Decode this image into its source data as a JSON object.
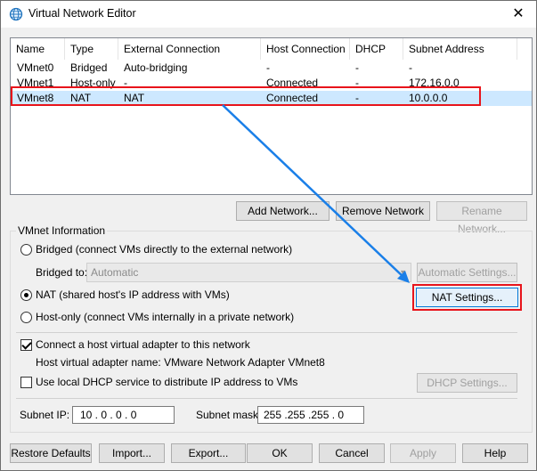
{
  "window": {
    "title": "Virtual Network Editor",
    "close_glyph": "✕"
  },
  "columns": [
    "Name",
    "Type",
    "External Connection",
    "Host Connection",
    "DHCP",
    "Subnet Address"
  ],
  "rows": [
    [
      "VMnet0",
      "Bridged",
      "Auto-bridging",
      "-",
      "-",
      "-"
    ],
    [
      "VMnet1",
      "Host-only",
      "-",
      "Connected",
      "-",
      "172.16.0.0"
    ],
    [
      "VMnet8",
      "NAT",
      "NAT",
      "Connected",
      "-",
      "10.0.0.0"
    ]
  ],
  "selected_row_index": 2,
  "network_buttons": {
    "add": "Add Network...",
    "remove": "Remove Network",
    "rename": "Rename Network..."
  },
  "vmnet_info": {
    "title": "VMnet Information",
    "bridged_label": "Bridged (connect VMs directly to the external network)",
    "bridged_to_label": "Bridged to:",
    "bridged_to_value": "Automatic",
    "automatic_settings": "Automatic Settings...",
    "nat_label": "NAT (shared host's IP address with VMs)",
    "nat_settings": "NAT Settings...",
    "host_only_label": "Host-only (connect VMs internally in a private network)",
    "connect_adapter_label": "Connect a host virtual adapter to this network",
    "adapter_name_label": "Host virtual adapter name: VMware Network Adapter VMnet8",
    "dhcp_label": "Use local DHCP service to distribute IP address to VMs",
    "dhcp_settings": "DHCP Settings...",
    "subnet_ip_label": "Subnet IP:",
    "subnet_ip": "10 . 0 . 0 . 0",
    "subnet_mask_label": "Subnet mask:",
    "subnet_mask": "255 .255 .255 . 0",
    "mode": "NAT",
    "connect_adapter_checked": true,
    "dhcp_checked": false
  },
  "footer": {
    "restore": "Restore Defaults",
    "import": "Import...",
    "export": "Export...",
    "ok": "OK",
    "cancel": "Cancel",
    "apply": "Apply",
    "help": "Help"
  },
  "colors": {
    "highlight_box": "#e8141b",
    "arrow": "#1a7fe8",
    "selection": "#cde8ff",
    "focus": "#0078d7"
  }
}
